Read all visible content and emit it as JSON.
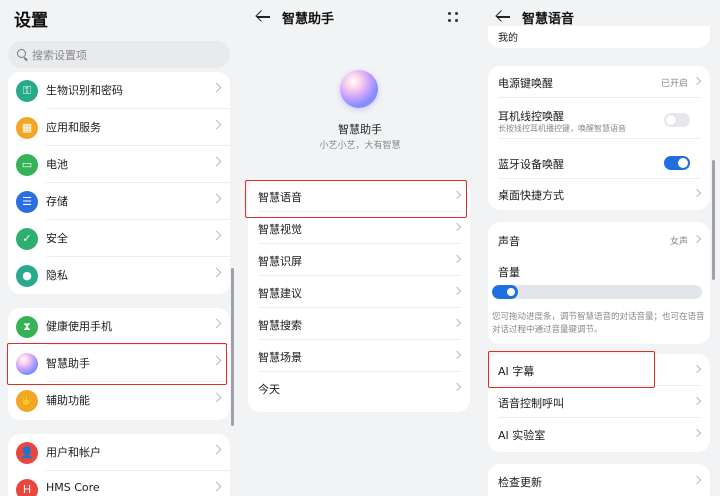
{
  "panel1": {
    "title": "设置",
    "search_placeholder": "搜索设置项",
    "group1": [
      {
        "label": "生物识别和密码",
        "icon": "key-icon",
        "color": "#27a98b",
        "glyph": "⚿"
      },
      {
        "label": "应用和服务",
        "icon": "apps-grid-icon",
        "color": "#f2a623",
        "glyph": "▦"
      },
      {
        "label": "电池",
        "icon": "battery-icon",
        "color": "#34b35a",
        "glyph": "▭"
      },
      {
        "label": "存储",
        "icon": "storage-icon",
        "color": "#2a6fe0",
        "glyph": "☰"
      },
      {
        "label": "安全",
        "icon": "shield-icon",
        "color": "#2fae72",
        "glyph": "✓"
      },
      {
        "label": "隐私",
        "icon": "privacy-icon",
        "color": "#2aa98f",
        "glyph": "●"
      }
    ],
    "group2": [
      {
        "label": "健康使用手机",
        "icon": "hourglass-icon",
        "color": "#36b356",
        "glyph": "⧗"
      },
      {
        "label": "智慧助手",
        "icon": "celia-orb-icon",
        "color": "#b48cff",
        "glyph": ""
      },
      {
        "label": "辅助功能",
        "icon": "hand-icon",
        "color": "#f2a623",
        "glyph": "✋"
      }
    ],
    "group3": [
      {
        "label": "用户和帐户",
        "icon": "user-icon",
        "color": "#e8473d",
        "glyph": "👤"
      },
      {
        "label": "HMS Core",
        "icon": "hms-icon",
        "color": "#e8473d",
        "glyph": "H"
      }
    ]
  },
  "panel2": {
    "title": "智慧助手",
    "assistant_name": "智慧助手",
    "assistant_tagline": "小艺小艺，大有智慧",
    "items": [
      "智慧语音",
      "智慧视觉",
      "智慧识屏",
      "智慧建议",
      "智慧搜索",
      "智慧场景",
      "今天"
    ]
  },
  "panel3": {
    "title": "智慧语音",
    "partial_top": "我的",
    "card1": {
      "power_key_wake": "电源键唤醒",
      "power_key_value": "已开启",
      "earphone_wake": "耳机线控唤醒",
      "earphone_wake_sub": "长按线控耳机播控键，唤醒智慧语音",
      "earphone_on": false,
      "bluetooth_wake": "蓝牙设备唤醒",
      "bluetooth_on": true,
      "desktop_shortcut": "桌面快捷方式"
    },
    "card2": {
      "voice_label": "声音",
      "voice_value": "女声",
      "volume_label": "音量",
      "volume_level": 0.1,
      "help_text": "您可拖动进度条，调节智慧语音的对话音量；也可在语音对话过程中通过音量键调节。"
    },
    "card3": [
      "AI 字幕",
      "语音控制呼叫",
      "AI 实验室"
    ],
    "card4": [
      "检查更新"
    ],
    "accent": "#1f6fe0",
    "highlight_color": "#d93025"
  }
}
